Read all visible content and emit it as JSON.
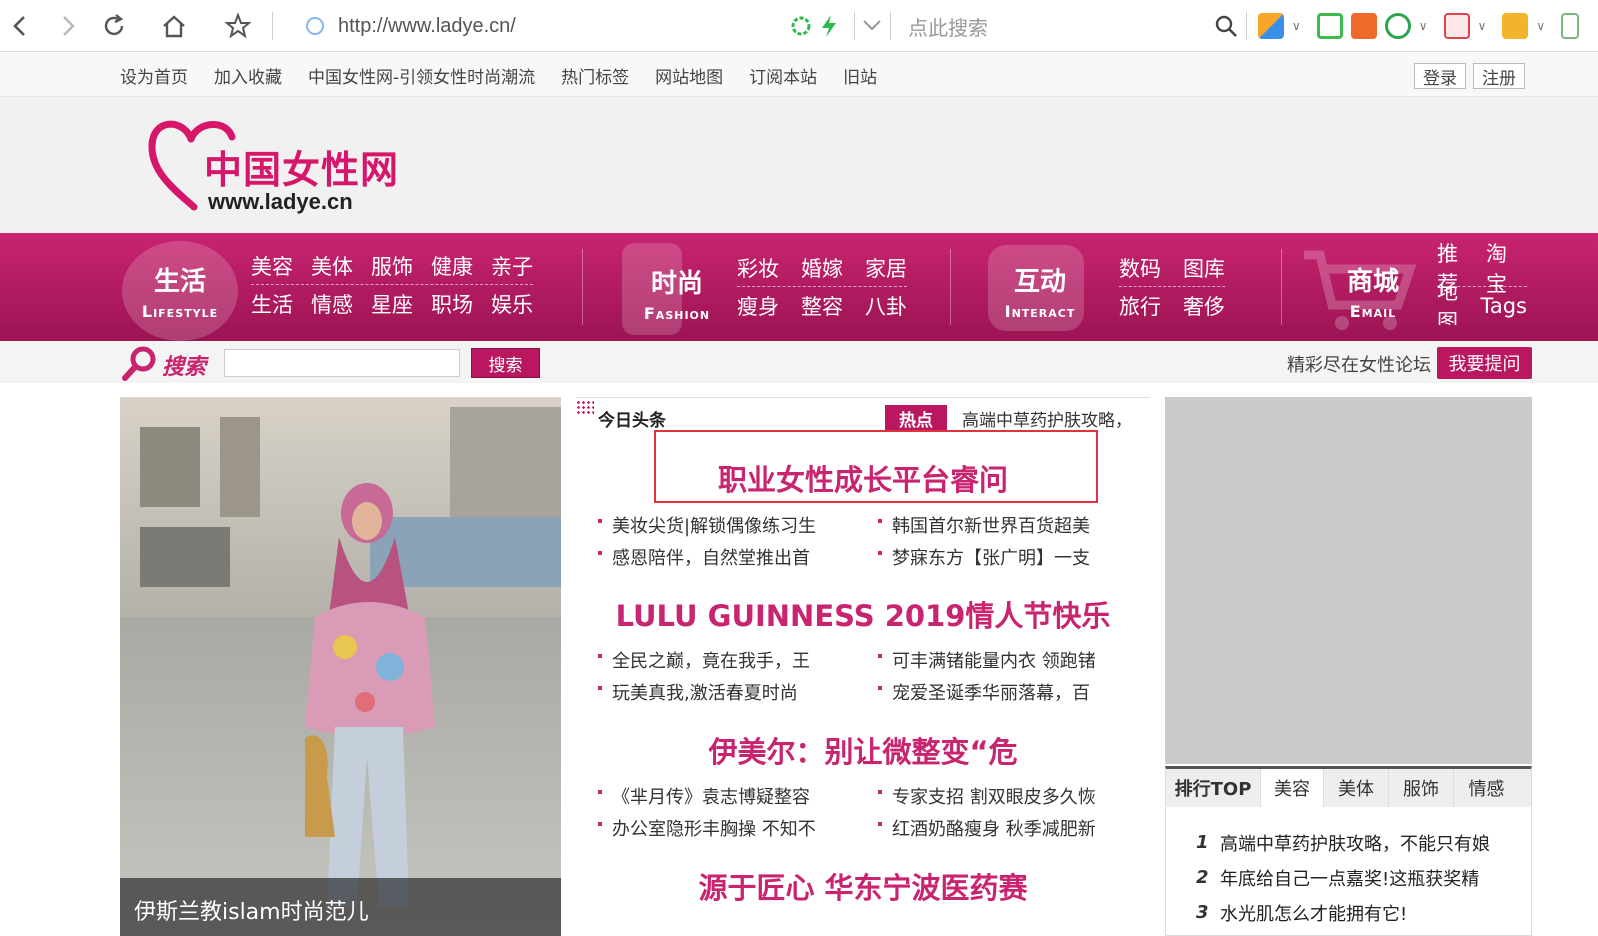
{
  "browser": {
    "url": "http://www.ladye.cn/",
    "search_placeholder": "点此搜索"
  },
  "toplinks": {
    "links": [
      "设为首页",
      "加入收藏",
      "中国女性网-引领女性时尚潮流",
      "热门标签",
      "网站地图",
      "订阅本站",
      "旧站"
    ],
    "login": "登录",
    "register": "注册"
  },
  "logo": {
    "name": "中国女性网",
    "url": "www.ladye.cn"
  },
  "mainnav": {
    "lifestyle": {
      "cn": "生活",
      "en": "Lifestyle",
      "row1": [
        "美容",
        "美体",
        "服饰",
        "健康",
        "亲子"
      ],
      "row2": [
        "生活",
        "情感",
        "星座",
        "职场",
        "娱乐"
      ]
    },
    "fashion": {
      "cn": "时尚",
      "en": "Fashion",
      "row1": [
        "彩妆",
        "婚嫁",
        "家居"
      ],
      "row2": [
        "瘦身",
        "整容",
        "八卦"
      ]
    },
    "interact": {
      "cn": "互动",
      "en": "Interact",
      "row1": [
        "数码",
        "图库"
      ],
      "row2": [
        "旅行",
        "奢侈"
      ]
    },
    "mall": {
      "cn": "商城",
      "en": "Email",
      "row1": [
        "推荐",
        "淘宝"
      ],
      "row2": [
        "地图",
        "Tags"
      ]
    }
  },
  "search": {
    "label": "搜索",
    "button": "搜索",
    "forum_text": "精彩尽在女性论坛",
    "ask_button": "我要提问"
  },
  "hero": {
    "caption": "伊斯兰教islam时尚范儿"
  },
  "headlines": {
    "title": "今日头条",
    "hot_tag": "热点",
    "hot_text": "高端中草药护肤攻略，",
    "groups": [
      {
        "headline": "职业女性成长平台睿问",
        "left": [
          "美妆尖货|解锁偶像练习生",
          "感恩陪伴，自然堂推出首"
        ],
        "right": [
          "韩国首尔新世界百货超美",
          "梦寐东方【张广明】一支"
        ]
      },
      {
        "headline": "LULU GUINNESS 2019情人节快乐",
        "left": [
          "全民之巅，竟在我手，王",
          "玩美真我,激活春夏时尚"
        ],
        "right": [
          "可丰满锗能量内衣 领跑锗",
          "宠爱圣诞季华丽落幕，百"
        ]
      },
      {
        "headline": "伊美尔：别让微整变“危",
        "left": [
          "《芈月传》袁志博疑整容",
          "办公室隐形丰胸操 不知不"
        ],
        "right": [
          "专家支招 割双眼皮多久恢",
          "红酒奶酪瘦身 秋季减肥新"
        ]
      },
      {
        "headline": "源于匠心 华东宁波医药赛",
        "left": [],
        "right": []
      }
    ]
  },
  "rank": {
    "title": "排行TOP",
    "tabs": [
      "美容",
      "美体",
      "服饰",
      "情感"
    ],
    "items": [
      {
        "num": "1",
        "text": "高端中草药护肤攻略，不能只有娘"
      },
      {
        "num": "2",
        "text": "年底给自己一点嘉奖!这瓶获奖精"
      },
      {
        "num": "3",
        "text": "水光肌怎么才能拥有它!"
      }
    ]
  }
}
